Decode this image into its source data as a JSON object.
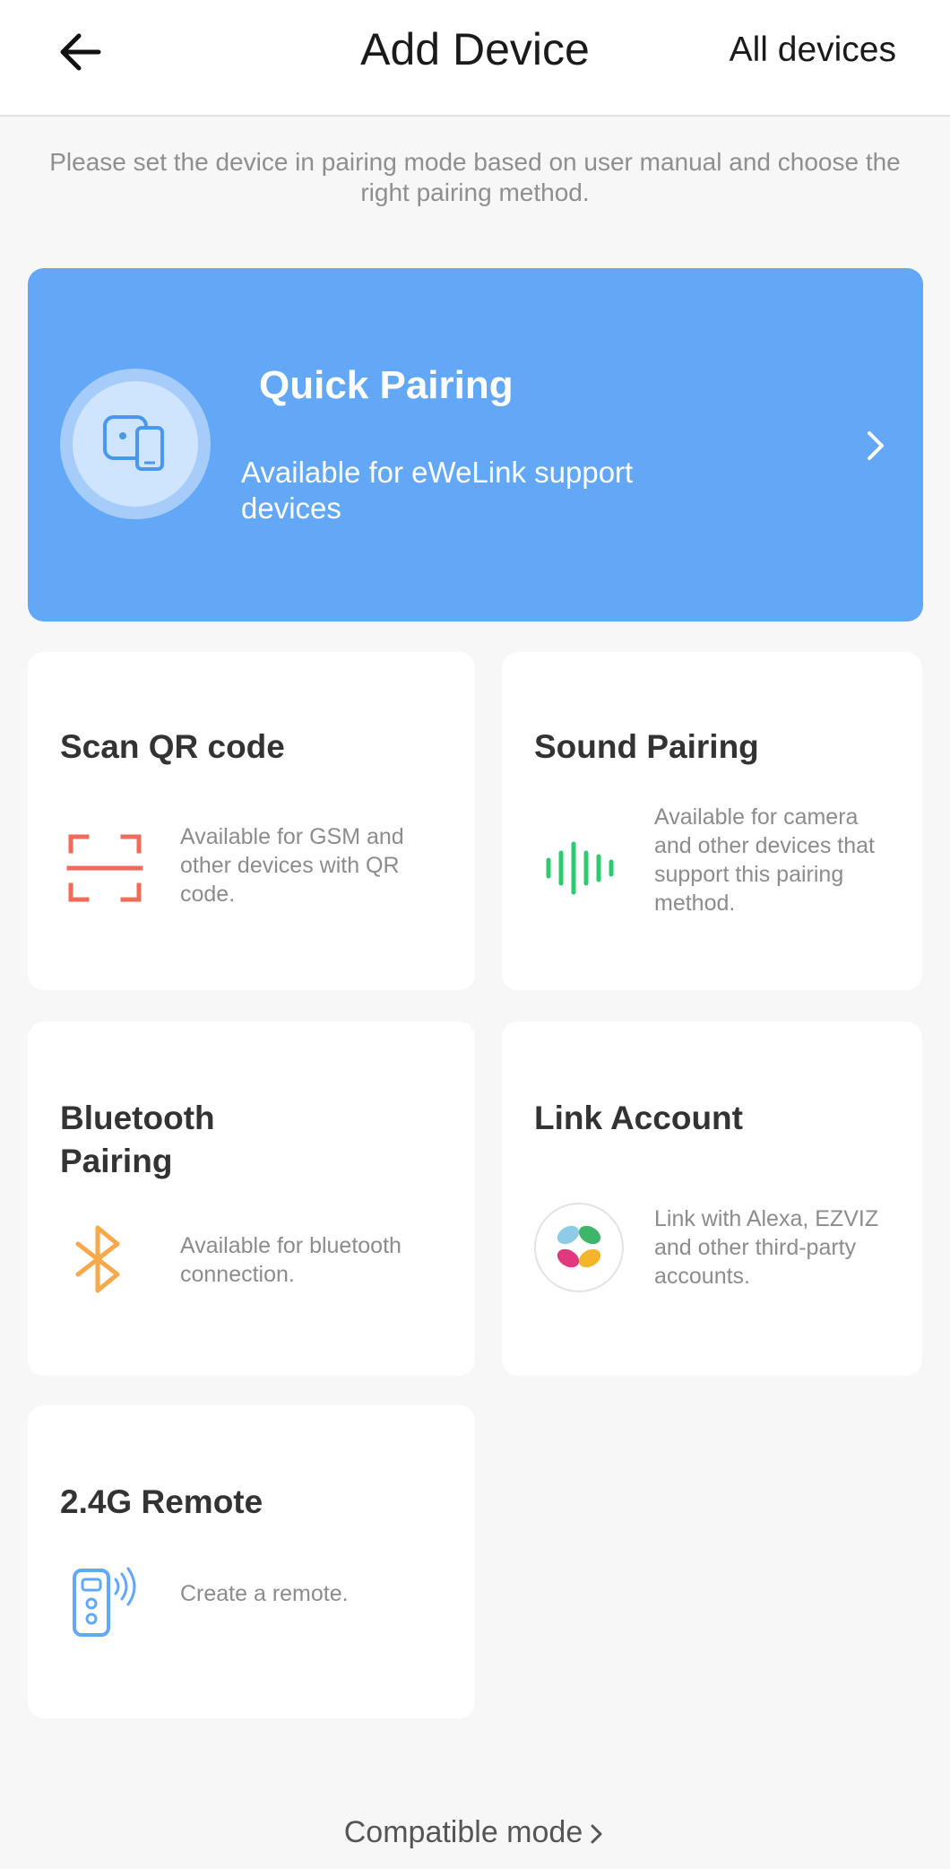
{
  "header": {
    "title": "Add Device",
    "all_devices": "All devices"
  },
  "instructions": "Please set the device in pairing mode based on user manual and choose the right pairing method.",
  "quick_pairing": {
    "title": "Quick Pairing",
    "description": "Available for eWeLink support devices",
    "color": "#62a8f7"
  },
  "methods": {
    "scan_qr": {
      "title": "Scan QR code",
      "description": "Available for GSM and other devices with QR code.",
      "icon": "qr-scan-icon",
      "color": "#ef6b5b"
    },
    "sound": {
      "title": "Sound Pairing",
      "description": "Available for camera and other devices that support this pairing method.",
      "icon": "sound-wave-icon",
      "color": "#2ec971"
    },
    "bluetooth": {
      "title": "Bluetooth Pairing",
      "description": "Available for bluetooth connection.",
      "icon": "bluetooth-icon",
      "color": "#f5a94a"
    },
    "link_account": {
      "title": "Link Account",
      "description": "Link with Alexa, EZVIZ and other third-party accounts.",
      "icon": "ezviz-logo-icon"
    },
    "remote": {
      "title": "2.4G Remote",
      "description": "Create a remote.",
      "icon": "remote-icon",
      "color": "#62a8f7"
    }
  },
  "footer": {
    "compatible_mode": "Compatible mode"
  }
}
